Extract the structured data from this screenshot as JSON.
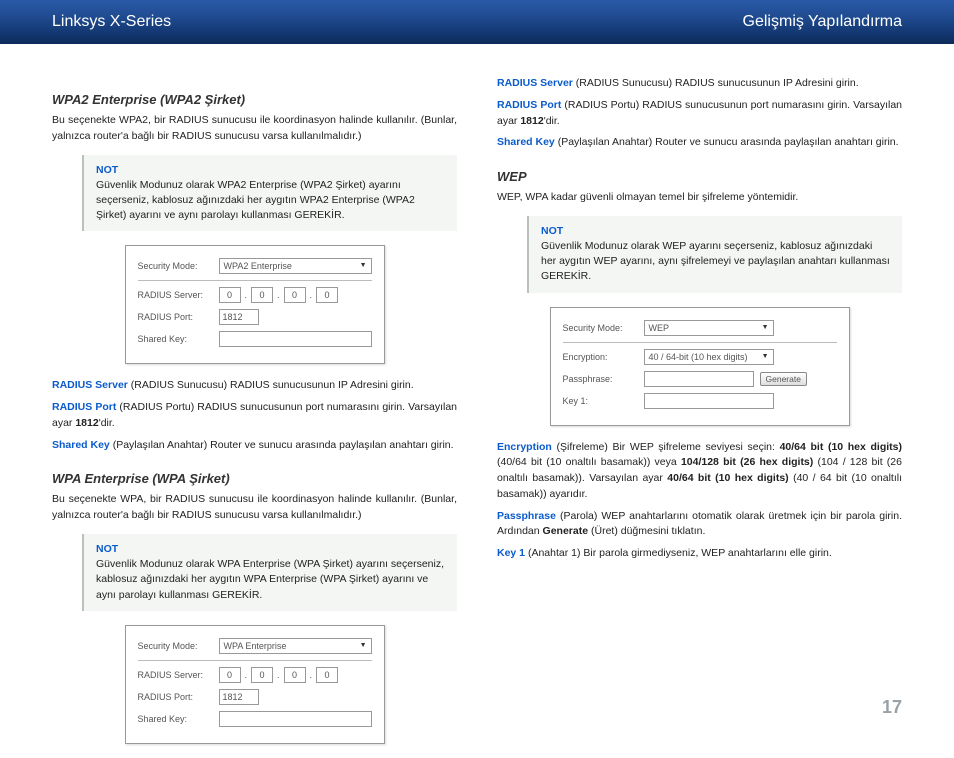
{
  "header": {
    "left": "Linksys X-Series",
    "right": "Gelişmiş Yapılandırma"
  },
  "left": {
    "wpa2e": {
      "title": "WPA2 Enterprise (WPA2 Şirket)",
      "body": "Bu seçenekte WPA2, bir RADIUS sunucusu ile koordinasyon halinde kullanılır. (Bunlar, yalnızca router'a bağlı bir RADIUS sunucusu varsa kullanılmalıdır.)",
      "note_label": "NOT",
      "note": "Güvenlik Modunuz olarak WPA2 Enterprise (WPA2 Şirket) ayarını seçerseniz, kablosuz ağınızdaki her aygıtın WPA2 Enterprise (WPA2 Şirket) ayarını ve aynı parolayı kullanması GEREKİR."
    },
    "fig1": {
      "security_mode_label": "Security Mode:",
      "security_mode_value": "WPA2 Enterprise",
      "radius_server_label": "RADIUS Server:",
      "ip": [
        "0",
        "0",
        "0",
        "0"
      ],
      "radius_port_label": "RADIUS Port:",
      "radius_port_value": "1812",
      "shared_key_label": "Shared Key:"
    },
    "radius_server": {
      "term": "RADIUS Server",
      "text": "(RADIUS Sunucusu)  RADIUS sunucusunun IP Adresini girin."
    },
    "radius_port": {
      "term": "RADIUS Port",
      "text1": "(RADIUS Portu) RADIUS sunucusunun port numarasını girin. Varsayılan ayar ",
      "bold": "1812",
      "text2": "'dir."
    },
    "shared_key": {
      "term": "Shared Key",
      "text": "(Paylaşılan Anahtar) Router ve sunucu arasında paylaşılan anahtarı girin."
    },
    "wpae": {
      "title": "WPA Enterprise (WPA Şirket)",
      "body": "Bu seçenekte WPA, bir RADIUS sunucusu ile koordinasyon halinde kullanılır. (Bunlar, yalnızca router'a bağlı bir RADIUS sunucusu varsa kullanılmalıdır.)",
      "note_label": "NOT",
      "note": "Güvenlik Modunuz olarak WPA Enterprise (WPA Şirket) ayarını seçerseniz, kablosuz ağınızdaki her aygıtın WPA Enterprise (WPA Şirket) ayarını ve aynı parolayı kullanması GEREKİR."
    },
    "fig2": {
      "security_mode_label": "Security Mode:",
      "security_mode_value": "WPA Enterprise",
      "radius_server_label": "RADIUS Server:",
      "ip": [
        "0",
        "0",
        "0",
        "0"
      ],
      "radius_port_label": "RADIUS Port:",
      "radius_port_value": "1812",
      "shared_key_label": "Shared Key:"
    }
  },
  "right": {
    "radius_server": {
      "term": "RADIUS Server",
      "text": "(RADIUS Sunucusu)  RADIUS sunucusunun IP Adresini girin."
    },
    "radius_port": {
      "term": "RADIUS Port",
      "text1": "(RADIUS Portu) RADIUS sunucusunun port numarasını girin. Varsayılan ayar ",
      "bold": "1812",
      "text2": "'dir."
    },
    "shared_key": {
      "term": "Shared Key",
      "text": "(Paylaşılan Anahtar) Router ve sunucu arasında paylaşılan anahtarı girin."
    },
    "wep": {
      "title": "WEP",
      "body": "WEP, WPA kadar güvenli olmayan temel bir şifreleme yöntemidir.",
      "note_label": "NOT",
      "note": "Güvenlik Modunuz olarak WEP ayarını seçerseniz, kablosuz ağınızdaki her aygıtın WEP ayarını, aynı şifrelemeyi ve paylaşılan anahtarı kullanması GEREKİR."
    },
    "fig3": {
      "security_mode_label": "Security Mode:",
      "security_mode_value": "WEP",
      "encryption_label": "Encryption:",
      "encryption_value": "40 / 64-bit (10 hex digits)",
      "passphrase_label": "Passphrase:",
      "generate_label": "Generate",
      "key1_label": "Key 1:"
    },
    "encryption": {
      "term": "Encryption",
      "pre": "(Şifreleme) Bir WEP şifreleme seviyesi seçin: ",
      "b1": "40/64 bit (10 hex digits)",
      "mid1": "(40/64 bit (10 onaltılı basamak)) veya ",
      "b2": "104/128 bit (26 hex digits)",
      "mid2": " (104 / 128 bit (26 onaltılı basamak)). Varsayılan ayar ",
      "b3": "40/64 bit (10 hex digits)",
      "post": " (40 / 64 bit (10 onaltılı basamak)) ayarıdır."
    },
    "passphrase": {
      "term": "Passphrase",
      "pre": "(Parola)  WEP anahtarlarını otomatik olarak üretmek için bir parola girin. Ardından ",
      "b": "Generate",
      "post": " (Üret) düğmesini tıklatın."
    },
    "key1": {
      "term": "Key 1",
      "text": "(Anahtar 1)  Bir parola girmediyseniz, WEP anahtarlarını elle girin."
    }
  },
  "page_number": "17"
}
